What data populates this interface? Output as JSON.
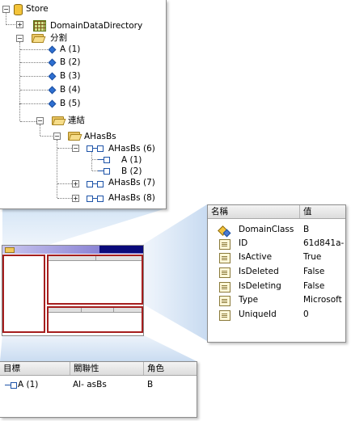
{
  "tree": {
    "store": "Store",
    "domain_data_directory": "DomainDataDirectory",
    "classes_folder": "分割",
    "classes": [
      "A (1)",
      "B (2)",
      "B (3)",
      "B (4)",
      "B (5)"
    ],
    "links_folder": "連結",
    "relationship_folder": "AHasBs",
    "relationship_items": [
      "AHasBs (6)",
      "AHasBs (7)",
      "AHasBs (8)"
    ],
    "role_items": [
      "A (1)",
      "B (2)"
    ]
  },
  "properties": {
    "col_name": "名稱",
    "col_value": "值",
    "rows": [
      {
        "name": "DomainClass",
        "value": "B"
      },
      {
        "name": "ID",
        "value": "61d841a-"
      },
      {
        "name": "IsActive",
        "value": "True"
      },
      {
        "name": "IsDeleted",
        "value": "False"
      },
      {
        "name": "IsDeleting",
        "value": "False"
      },
      {
        "name": "Type",
        "value": "Microsoft"
      },
      {
        "name": "UniqueId",
        "value": "0"
      }
    ]
  },
  "links_grid": {
    "col_target": "目標",
    "col_relationship": "關聯性",
    "col_role": "角色",
    "rows": [
      {
        "target": "A (1)",
        "relationship": "Al- asBs",
        "role": "B"
      }
    ]
  },
  "colors": {
    "accent": "#1d53a8",
    "callout_fill": "#cfe0f3",
    "border_red": "#a51e1e"
  }
}
